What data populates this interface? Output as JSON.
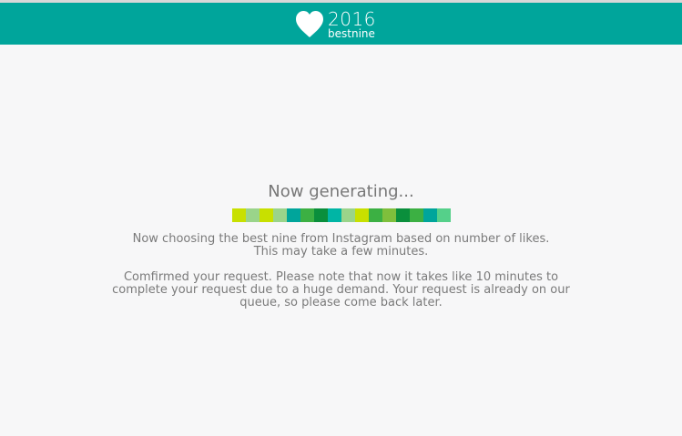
{
  "header": {
    "logo_year": "2016",
    "logo_brand": "bestnine",
    "background_color": "#00a59b"
  },
  "main": {
    "title": "Now generating...",
    "progress_colors": [
      "#c8e000",
      "#9ad48a",
      "#c8e000",
      "#9ad48a",
      "#00a59b",
      "#3cb043",
      "#0a8f3c",
      "#00b5a5",
      "#9ad48a",
      "#c8e000",
      "#3cb043",
      "#7fbf3c",
      "#0a8f3c",
      "#3cb043",
      "#00a59b",
      "#55d08a"
    ],
    "message_line1": "Now choosing the best nine from Instagram based on number of likes.",
    "message_line2": "This may take a few minutes.",
    "notice_line1": "Comfirmed your request. Please note that now it takes like 10 minutes to",
    "notice_line2": "complete your request due to a huge demand. Your request is already on our",
    "notice_line3": "queue, so please come back later."
  }
}
